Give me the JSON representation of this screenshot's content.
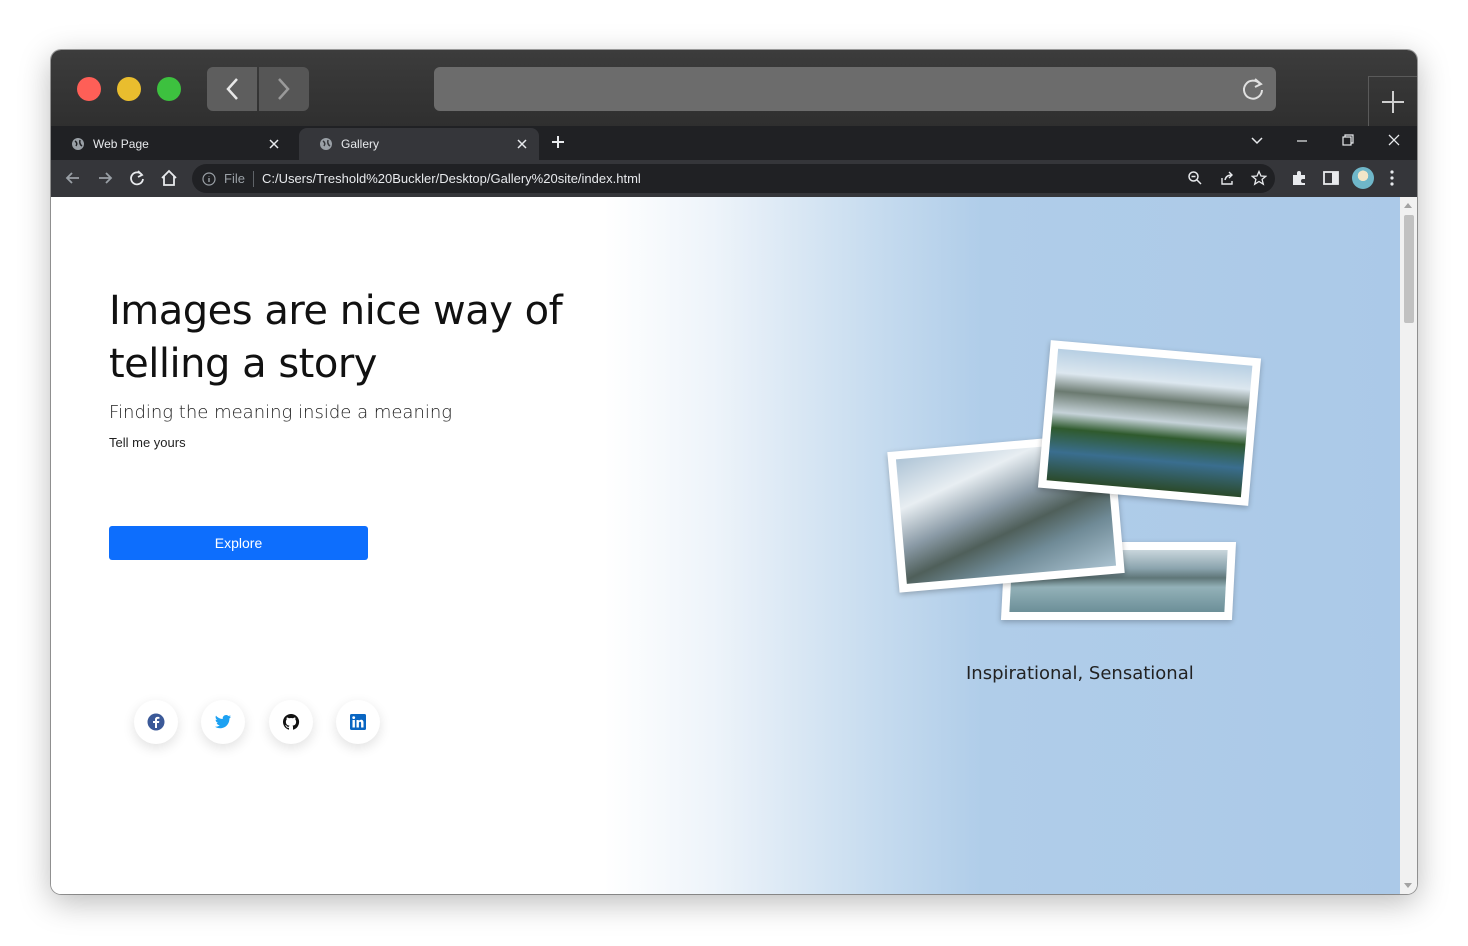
{
  "browser": {
    "tabs": [
      {
        "label": "Web Page"
      },
      {
        "label": "Gallery"
      }
    ],
    "address": {
      "scheme_label": "File",
      "url": "C:/Users/Treshold%20Buckler/Desktop/Gallery%20site/index.html"
    }
  },
  "page": {
    "title": "Images are nice way of telling a story",
    "subtitle": "Finding the meaning inside a meaning",
    "tagline": "Tell me yours",
    "explore_label": "Explore",
    "caption": "Inspirational, Sensational",
    "social": [
      {
        "name": "facebook-icon",
        "color": "#3b5998"
      },
      {
        "name": "twitter-icon",
        "color": "#1da1f2"
      },
      {
        "name": "github-icon",
        "color": "#111111"
      },
      {
        "name": "linkedin-icon",
        "color": "#0a66c2"
      }
    ]
  },
  "colors": {
    "accent": "#0d6efd",
    "gradient_end": "#abc9e8"
  }
}
